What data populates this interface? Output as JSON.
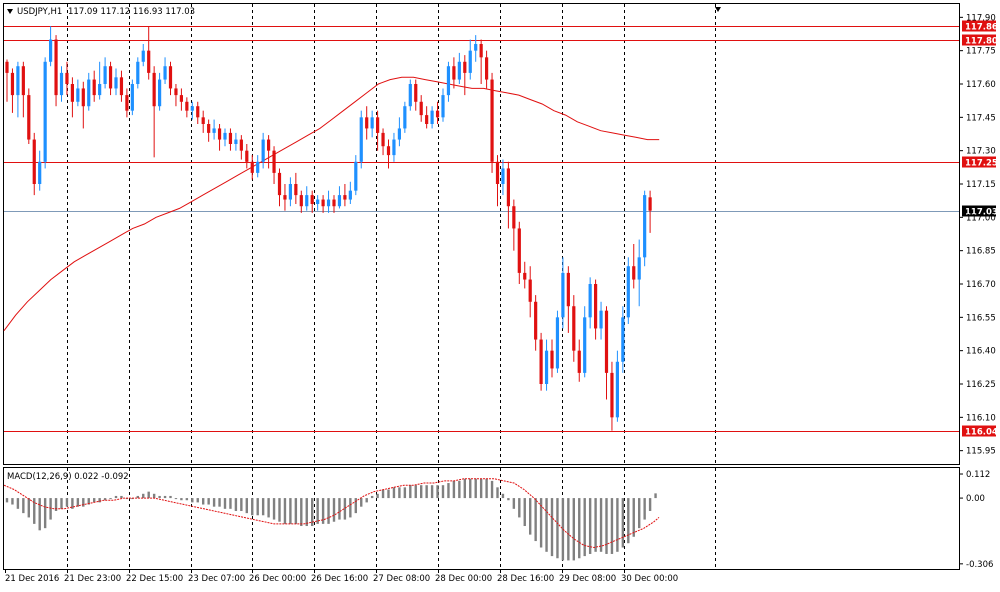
{
  "chart_data": {
    "type": "candlestick",
    "symbol_label": "USDJPY,H1",
    "ohlc_label": "117.09 117.12 116.93 117.03",
    "current_price": 117.03,
    "price_axis": {
      "ylim": [
        115.89,
        117.96
      ],
      "ticks": [
        "117.90",
        "117.75",
        "117.60",
        "117.45",
        "117.30",
        "117.15",
        "117.00",
        "116.85",
        "116.70",
        "116.55",
        "116.40",
        "116.25",
        "116.10",
        "115.95"
      ]
    },
    "horizontal_levels": [
      {
        "value": 117.86,
        "label": "117.86",
        "color": "#e01010"
      },
      {
        "value": 117.8,
        "label": "117.80",
        "color": "#e01010"
      },
      {
        "value": 117.25,
        "label": "117.25",
        "color": "#e01010"
      },
      {
        "value": 116.04,
        "label": "116.04",
        "color": "#e01010"
      }
    ],
    "x_labels": [
      "21 Dec 2016",
      "21 Dec 23:00",
      "22 Dec 15:00",
      "23 Dec 07:00",
      "26 Dec 00:00",
      "26 Dec 16:00",
      "27 Dec 08:00",
      "28 Dec 00:00",
      "28 Dec 16:00",
      "29 Dec 08:00",
      "30 Dec 00:00"
    ],
    "colors": {
      "bull": "#1e90ff",
      "bear": "#e01010",
      "ma": "#e01010",
      "grid": "#000000",
      "macd_hist": "#808080",
      "macd_signal": "#e01010"
    },
    "moving_average_path": [
      [
        0,
        116.49
      ],
      [
        10,
        116.56
      ],
      [
        20,
        116.62
      ],
      [
        30,
        116.67
      ],
      [
        40,
        116.72
      ],
      [
        50,
        116.76
      ],
      [
        60,
        116.8
      ],
      [
        70,
        116.83
      ],
      [
        80,
        116.86
      ],
      [
        90,
        116.89
      ],
      [
        100,
        116.92
      ],
      [
        110,
        116.95
      ],
      [
        120,
        116.97
      ],
      [
        130,
        117.0
      ],
      [
        140,
        117.02
      ],
      [
        150,
        117.04
      ],
      [
        160,
        117.07
      ],
      [
        170,
        117.1
      ],
      [
        180,
        117.13
      ],
      [
        190,
        117.16
      ],
      [
        200,
        117.19
      ],
      [
        210,
        117.22
      ],
      [
        220,
        117.25
      ],
      [
        230,
        117.28
      ],
      [
        240,
        117.31
      ],
      [
        250,
        117.34
      ],
      [
        260,
        117.37
      ],
      [
        270,
        117.4
      ],
      [
        280,
        117.44
      ],
      [
        290,
        117.48
      ],
      [
        300,
        117.52
      ],
      [
        310,
        117.56
      ],
      [
        320,
        117.6
      ],
      [
        330,
        117.62
      ],
      [
        340,
        117.63
      ],
      [
        350,
        117.63
      ],
      [
        360,
        117.62
      ],
      [
        370,
        117.61
      ],
      [
        380,
        117.6
      ],
      [
        390,
        117.59
      ],
      [
        400,
        117.58
      ],
      [
        410,
        117.58
      ],
      [
        420,
        117.57
      ],
      [
        430,
        117.56
      ],
      [
        440,
        117.55
      ],
      [
        450,
        117.53
      ],
      [
        460,
        117.51
      ],
      [
        470,
        117.48
      ],
      [
        480,
        117.46
      ],
      [
        490,
        117.43
      ],
      [
        500,
        117.41
      ],
      [
        510,
        117.39
      ],
      [
        520,
        117.38
      ],
      [
        530,
        117.37
      ],
      [
        540,
        117.36
      ],
      [
        550,
        117.35
      ],
      [
        560,
        117.35
      ]
    ],
    "candles": [
      [
        117.7,
        117.65,
        117.71,
        117.52
      ],
      [
        117.65,
        117.55,
        117.67,
        117.47
      ],
      [
        117.55,
        117.68,
        117.7,
        117.45
      ],
      [
        117.68,
        117.55,
        117.7,
        117.45
      ],
      [
        117.55,
        117.35,
        117.58,
        117.33
      ],
      [
        117.35,
        117.15,
        117.38,
        117.1
      ],
      [
        117.15,
        117.25,
        117.3,
        117.12
      ],
      [
        117.25,
        117.7,
        117.72,
        117.22
      ],
      [
        117.7,
        117.8,
        117.86,
        117.68
      ],
      [
        117.8,
        117.55,
        117.82,
        117.5
      ],
      [
        117.55,
        117.65,
        117.68,
        117.52
      ],
      [
        117.65,
        117.6,
        117.7,
        117.55
      ],
      [
        117.6,
        117.52,
        117.63,
        117.45
      ],
      [
        117.52,
        117.58,
        117.62,
        117.5
      ],
      [
        117.58,
        117.5,
        117.61,
        117.4
      ],
      [
        117.5,
        117.62,
        117.65,
        117.48
      ],
      [
        117.62,
        117.55,
        117.66,
        117.52
      ],
      [
        117.55,
        117.6,
        117.7,
        117.53
      ],
      [
        117.6,
        117.68,
        117.72,
        117.58
      ],
      [
        117.68,
        117.58,
        117.7,
        117.55
      ],
      [
        117.58,
        117.63,
        117.67,
        117.55
      ],
      [
        117.63,
        117.55,
        117.66,
        117.52
      ],
      [
        117.55,
        117.48,
        117.58,
        117.45
      ],
      [
        117.48,
        117.6,
        117.62,
        117.46
      ],
      [
        117.6,
        117.7,
        117.72,
        117.58
      ],
      [
        117.7,
        117.75,
        117.78,
        117.68
      ],
      [
        117.75,
        117.65,
        117.86,
        117.62
      ],
      [
        117.65,
        117.5,
        117.68,
        117.27
      ],
      [
        117.5,
        117.62,
        117.65,
        117.48
      ],
      [
        117.62,
        117.68,
        117.72,
        117.6
      ],
      [
        117.68,
        117.58,
        117.7,
        117.55
      ],
      [
        117.58,
        117.55,
        117.6,
        117.5
      ],
      [
        117.55,
        117.52,
        117.58,
        117.48
      ],
      [
        117.52,
        117.48,
        117.54,
        117.45
      ],
      [
        117.48,
        117.5,
        117.52,
        117.44
      ],
      [
        117.5,
        117.45,
        117.52,
        117.42
      ],
      [
        117.45,
        117.42,
        117.48,
        117.38
      ],
      [
        117.42,
        117.38,
        117.44,
        117.34
      ],
      [
        117.38,
        117.4,
        117.44,
        117.35
      ],
      [
        117.4,
        117.35,
        117.42,
        117.3
      ],
      [
        117.35,
        117.38,
        117.4,
        117.32
      ],
      [
        117.38,
        117.33,
        117.4,
        117.3
      ],
      [
        117.33,
        117.35,
        117.38,
        117.3
      ],
      [
        117.35,
        117.3,
        117.37,
        117.26
      ],
      [
        117.3,
        117.25,
        117.33,
        117.22
      ],
      [
        117.25,
        117.2,
        117.28,
        117.17
      ],
      [
        117.2,
        117.25,
        117.28,
        117.18
      ],
      [
        117.25,
        117.35,
        117.38,
        117.22
      ],
      [
        117.35,
        117.3,
        117.37,
        117.22
      ],
      [
        117.3,
        117.2,
        117.32,
        117.15
      ],
      [
        117.2,
        117.1,
        117.22,
        117.05
      ],
      [
        117.1,
        117.08,
        117.15,
        117.03
      ],
      [
        117.08,
        117.15,
        117.18,
        117.05
      ],
      [
        117.15,
        117.1,
        117.2,
        117.06
      ],
      [
        117.1,
        117.05,
        117.12,
        117.02
      ],
      [
        117.05,
        117.1,
        117.14,
        117.03
      ],
      [
        117.1,
        117.06,
        117.12,
        117.02
      ],
      [
        117.06,
        117.08,
        117.1,
        117.03
      ],
      [
        117.08,
        117.05,
        117.1,
        117.02
      ],
      [
        117.05,
        117.08,
        117.12,
        117.02
      ],
      [
        117.08,
        117.05,
        117.1,
        117.02
      ],
      [
        117.05,
        117.1,
        117.14,
        117.04
      ],
      [
        117.1,
        117.08,
        117.15,
        117.05
      ],
      [
        117.08,
        117.12,
        117.16,
        117.06
      ],
      [
        117.12,
        117.25,
        117.28,
        117.1
      ],
      [
        117.25,
        117.45,
        117.48,
        117.22
      ],
      [
        117.45,
        117.4,
        117.5,
        117.35
      ],
      [
        117.4,
        117.45,
        117.48,
        117.36
      ],
      [
        117.45,
        117.38,
        117.48,
        117.3
      ],
      [
        117.38,
        117.32,
        117.4,
        117.28
      ],
      [
        117.32,
        117.28,
        117.35,
        117.22
      ],
      [
        117.28,
        117.35,
        117.38,
        117.25
      ],
      [
        117.35,
        117.4,
        117.45,
        117.32
      ],
      [
        117.4,
        117.5,
        117.52,
        117.38
      ],
      [
        117.5,
        117.6,
        117.62,
        117.48
      ],
      [
        117.6,
        117.52,
        117.62,
        117.48
      ],
      [
        117.52,
        117.46,
        117.55,
        117.43
      ],
      [
        117.46,
        117.42,
        117.5,
        117.4
      ],
      [
        117.42,
        117.48,
        117.5,
        117.4
      ],
      [
        117.48,
        117.45,
        117.52,
        117.42
      ],
      [
        117.45,
        117.55,
        117.58,
        117.43
      ],
      [
        117.55,
        117.68,
        117.7,
        117.52
      ],
      [
        117.68,
        117.62,
        117.72,
        117.58
      ],
      [
        117.62,
        117.7,
        117.74,
        117.6
      ],
      [
        117.7,
        117.65,
        117.73,
        117.55
      ],
      [
        117.65,
        117.75,
        117.8,
        117.62
      ],
      [
        117.75,
        117.78,
        117.82,
        117.7
      ],
      [
        117.78,
        117.72,
        117.8,
        117.6
      ],
      [
        117.72,
        117.62,
        117.75,
        117.58
      ],
      [
        117.62,
        117.25,
        117.65,
        117.2
      ],
      [
        117.25,
        117.15,
        117.28,
        117.05
      ],
      [
        117.15,
        117.22,
        117.26,
        117.1
      ],
      [
        117.22,
        117.05,
        117.25,
        116.95
      ],
      [
        117.05,
        116.95,
        117.08,
        116.85
      ],
      [
        116.95,
        116.75,
        116.98,
        116.7
      ],
      [
        116.75,
        116.72,
        116.8,
        116.68
      ],
      [
        116.72,
        116.62,
        116.78,
        116.55
      ],
      [
        116.62,
        116.45,
        116.65,
        116.4
      ],
      [
        116.45,
        116.25,
        116.48,
        116.22
      ],
      [
        116.25,
        116.4,
        116.45,
        116.22
      ],
      [
        116.4,
        116.32,
        116.45,
        116.28
      ],
      [
        116.32,
        116.55,
        116.58,
        116.3
      ],
      [
        116.55,
        116.75,
        116.82,
        116.5
      ],
      [
        116.75,
        116.6,
        116.78,
        116.48
      ],
      [
        116.6,
        116.4,
        116.65,
        116.35
      ],
      [
        116.4,
        116.3,
        116.45,
        116.26
      ],
      [
        116.3,
        116.55,
        116.6,
        116.28
      ],
      [
        116.55,
        116.7,
        116.73,
        116.5
      ],
      [
        116.7,
        116.5,
        116.72,
        116.45
      ],
      [
        116.5,
        116.58,
        116.62,
        116.45
      ],
      [
        116.58,
        116.3,
        116.6,
        116.18
      ],
      [
        116.3,
        116.1,
        116.35,
        116.04
      ],
      [
        116.1,
        116.35,
        116.4,
        116.08
      ],
      [
        116.35,
        116.55,
        116.6,
        116.3
      ],
      [
        116.55,
        116.78,
        116.82,
        116.52
      ],
      [
        116.78,
        116.72,
        116.88,
        116.68
      ],
      [
        116.72,
        116.82,
        116.9,
        116.6
      ],
      [
        116.82,
        117.1,
        117.12,
        116.78
      ],
      [
        117.09,
        117.03,
        117.12,
        116.93
      ]
    ],
    "macd": {
      "label": "MACD(12,26,9) 0.022 -0.092",
      "ylim": [
        -0.33,
        0.14
      ],
      "ticks": [
        "0.112",
        "0.00",
        "-0.306"
      ],
      "histogram": [
        -0.02,
        -0.03,
        -0.05,
        -0.07,
        -0.09,
        -0.12,
        -0.15,
        -0.14,
        -0.1,
        -0.06,
        -0.05,
        -0.04,
        -0.05,
        -0.04,
        -0.04,
        -0.03,
        -0.02,
        -0.02,
        -0.01,
        0.0,
        0.01,
        0.01,
        0.0,
        0.0,
        0.01,
        0.02,
        0.03,
        0.02,
        0.01,
        0.01,
        0.01,
        0.0,
        -0.01,
        -0.01,
        -0.02,
        -0.02,
        -0.03,
        -0.03,
        -0.04,
        -0.04,
        -0.05,
        -0.05,
        -0.06,
        -0.06,
        -0.07,
        -0.08,
        -0.08,
        -0.08,
        -0.09,
        -0.1,
        -0.11,
        -0.12,
        -0.12,
        -0.12,
        -0.13,
        -0.13,
        -0.13,
        -0.12,
        -0.12,
        -0.12,
        -0.11,
        -0.1,
        -0.1,
        -0.09,
        -0.07,
        -0.04,
        -0.02,
        0.01,
        0.02,
        0.04,
        0.04,
        0.05,
        0.05,
        0.05,
        0.06,
        0.06,
        0.06,
        0.06,
        0.06,
        0.06,
        0.06,
        0.07,
        0.08,
        0.08,
        0.09,
        0.09,
        0.09,
        0.09,
        0.09,
        0.08,
        0.05,
        0.02,
        -0.01,
        -0.05,
        -0.09,
        -0.13,
        -0.17,
        -0.2,
        -0.23,
        -0.25,
        -0.27,
        -0.28,
        -0.29,
        -0.29,
        -0.29,
        -0.28,
        -0.27,
        -0.26,
        -0.25,
        -0.25,
        -0.26,
        -0.26,
        -0.25,
        -0.23,
        -0.21,
        -0.18,
        -0.14,
        -0.1,
        -0.06,
        0.022
      ],
      "signal": [
        [
          0,
          0.06
        ],
        [
          10,
          0.04
        ],
        [
          20,
          0.01
        ],
        [
          30,
          -0.02
        ],
        [
          40,
          -0.04
        ],
        [
          50,
          -0.05
        ],
        [
          60,
          -0.05
        ],
        [
          70,
          -0.04
        ],
        [
          80,
          -0.03
        ],
        [
          90,
          -0.02
        ],
        [
          100,
          -0.01
        ],
        [
          110,
          -0.01
        ],
        [
          120,
          0.0
        ],
        [
          130,
          0.0
        ],
        [
          140,
          0.0
        ],
        [
          150,
          0.0
        ],
        [
          160,
          -0.01
        ],
        [
          170,
          -0.02
        ],
        [
          180,
          -0.03
        ],
        [
          190,
          -0.04
        ],
        [
          200,
          -0.05
        ],
        [
          210,
          -0.06
        ],
        [
          220,
          -0.07
        ],
        [
          230,
          -0.08
        ],
        [
          240,
          -0.09
        ],
        [
          250,
          -0.1
        ],
        [
          260,
          -0.11
        ],
        [
          270,
          -0.12
        ],
        [
          280,
          -0.12
        ],
        [
          290,
          -0.12
        ],
        [
          300,
          -0.12
        ],
        [
          310,
          -0.11
        ],
        [
          320,
          -0.1
        ],
        [
          330,
          -0.08
        ],
        [
          340,
          -0.05
        ],
        [
          350,
          -0.02
        ],
        [
          360,
          0.01
        ],
        [
          370,
          0.03
        ],
        [
          380,
          0.04
        ],
        [
          390,
          0.05
        ],
        [
          400,
          0.06
        ],
        [
          410,
          0.06
        ],
        [
          420,
          0.07
        ],
        [
          430,
          0.07
        ],
        [
          440,
          0.08
        ],
        [
          450,
          0.08
        ],
        [
          460,
          0.09
        ],
        [
          470,
          0.09
        ],
        [
          480,
          0.09
        ],
        [
          490,
          0.09
        ],
        [
          500,
          0.08
        ],
        [
          510,
          0.07
        ],
        [
          520,
          0.04
        ],
        [
          530,
          0.0
        ],
        [
          540,
          -0.05
        ],
        [
          550,
          -0.1
        ],
        [
          560,
          -0.15
        ],
        [
          570,
          -0.19
        ],
        [
          580,
          -0.22
        ],
        [
          590,
          -0.23
        ],
        [
          600,
          -0.22
        ],
        [
          610,
          -0.2
        ],
        [
          620,
          -0.18
        ],
        [
          630,
          -0.16
        ],
        [
          640,
          -0.14
        ],
        [
          650,
          -0.11
        ],
        [
          655,
          -0.09
        ]
      ]
    }
  }
}
